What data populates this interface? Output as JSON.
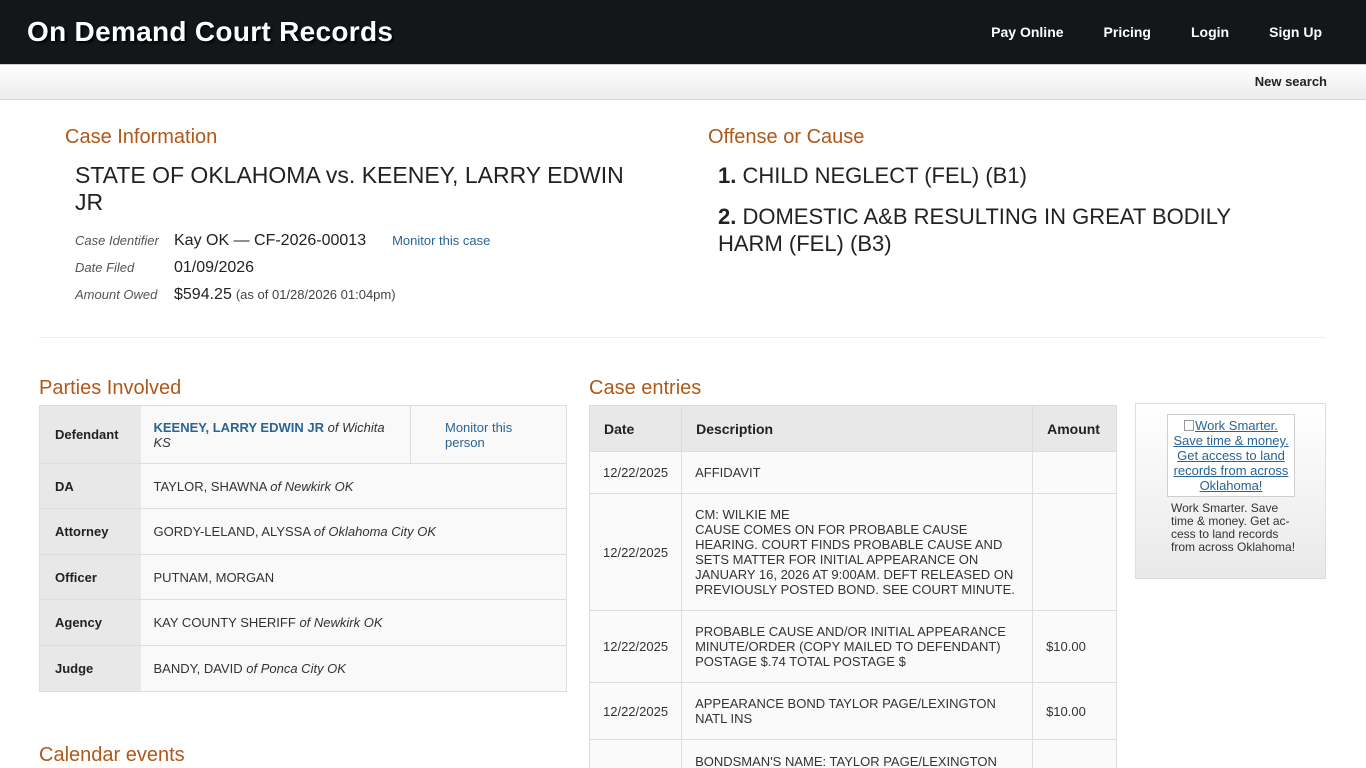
{
  "header": {
    "brand": "On Demand Court Records",
    "nav": [
      "Pay Online",
      "Pricing",
      "Login",
      "Sign Up"
    ],
    "new_search": "New search"
  },
  "case_info": {
    "section_title": "Case Information",
    "title": "STATE OF OKLAHOMA vs. KEENEY, LARRY EDWIN JR",
    "identifier_label": "Case Identifier",
    "identifier": "Kay OK — CF-2026-00013",
    "monitor_case": "Monitor this case",
    "filed_label": "Date Filed",
    "filed": "01/09/2026",
    "owed_label": "Amount Owed",
    "owed": "$594.25",
    "owed_asof": "(as of 01/28/2026 01:04pm)"
  },
  "offense": {
    "section_title": "Offense or Cause",
    "items": [
      {
        "num": "1.",
        "text": "CHILD NEGLECT (FEL) (B1)"
      },
      {
        "num": "2.",
        "text": "DOMESTIC A&B RESULTING IN GREAT BODILY HARM (FEL) (B3)"
      }
    ]
  },
  "parties": {
    "section_title": "Parties Involved",
    "monitor_person": "Monitor this person",
    "of_word": "of",
    "rows": [
      {
        "role": "Defendant",
        "name": "KEENEY, LARRY EDWIN JR",
        "location": "Wichita KS"
      },
      {
        "role": "DA",
        "name": "TAYLOR, SHAWNA",
        "location": "Newkirk OK"
      },
      {
        "role": "Attorney",
        "name": "GORDY-LELAND, ALYSSA",
        "location": "Oklahoma City OK"
      },
      {
        "role": "Officer",
        "name": "PUTNAM, MORGAN",
        "location": ""
      },
      {
        "role": "Agency",
        "name": "KAY COUNTY SHERIFF",
        "location": "Newkirk OK"
      },
      {
        "role": "Judge",
        "name": "BANDY, DAVID",
        "location": "Ponca City OK"
      }
    ]
  },
  "calendar": {
    "section_title": "Calendar events"
  },
  "entries": {
    "section_title": "Case entries",
    "headers": {
      "date": "Date",
      "description": "Description",
      "amount": "Amount"
    },
    "rows": [
      {
        "date": "12/22/2025",
        "description": "AFFIDAVIT",
        "amount": ""
      },
      {
        "date": "12/22/2025",
        "description": "CM: WILKIE ME\nCAUSE COMES ON FOR PROBABLE CAUSE HEARING. COURT FINDS PROBABLE CAUSE AND SETS MATTER FOR INITIAL APPEARANCE ON JANUARY 16, 2026 AT 9:00AM. DEFT RELEASED ON PREVIOUSLY POSTED BOND. SEE COURT MINUTE.",
        "amount": ""
      },
      {
        "date": "12/22/2025",
        "description": "PROBABLE CAUSE AND/OR INITIAL APPEARANCE MINUTE/ORDER (COPY MAILED TO DEFENDANT) POSTAGE $.74 TOTAL POSTAGE $",
        "amount": "$10.00"
      },
      {
        "date": "12/22/2025",
        "description": "APPEARANCE BOND TAYLOR PAGE/LEXINGTON NATL INS",
        "amount": "$10.00"
      },
      {
        "date": "",
        "description": "BONDSMAN'S NAME: TAYLOR PAGE/LEXINGTON",
        "amount": ""
      }
    ]
  },
  "ad": {
    "image_alt": "Work Smarter. Save time & money. Get access to land records from across Oklahoma!",
    "caption": "Work Smarter. Save time & money. Get ac-cess to land records from across Oklahoma!"
  }
}
